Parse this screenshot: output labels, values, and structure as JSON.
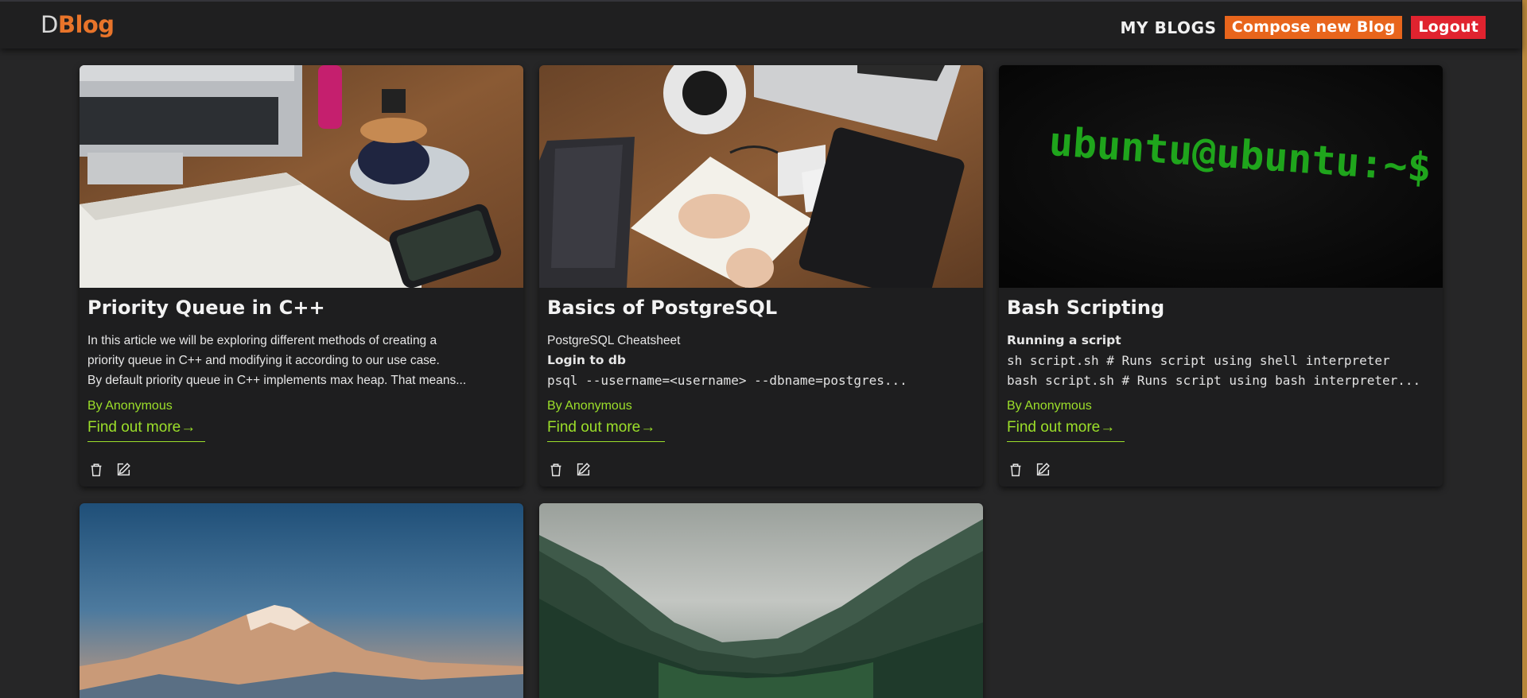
{
  "navbar": {
    "brand_d": "D",
    "brand_blog": "Blog",
    "my_blogs": "MY BLOGS",
    "compose": "Compose new Blog",
    "logout": "Logout"
  },
  "colors": {
    "accent_green": "#9cdf2a",
    "brand_orange": "#e8742a",
    "compose_orange": "#e8651c",
    "logout_red": "#e0232f"
  },
  "cards": [
    {
      "title": "Priority Queue in C++",
      "lines": [
        "In this article we will be exploring different methods of creating a",
        "priority queue in C++ and modifying it according to our use case.",
        "By default priority queue in C++ implements max heap. That means..."
      ],
      "author": "By Anonymous",
      "more": "Find out more→",
      "image": "desk-notebook-coffee-phone",
      "delete_icon": "trash-icon",
      "edit_icon": "edit-icon"
    },
    {
      "title": "Basics of PostgreSQL",
      "line1": "PostgreSQL Cheatsheet",
      "line2": "Login to db",
      "line3": "psql --username=<username> --dbname=postgres...",
      "author": "By Anonymous",
      "more": "Find out more→",
      "image": "desk-journal-writing-tablet",
      "delete_icon": "trash-icon",
      "edit_icon": "edit-icon"
    },
    {
      "title": "Bash Scripting",
      "line1": "Running a script",
      "line2": "sh script.sh  # Runs script using shell interpreter",
      "line3": "bash script.sh # Runs script using bash interpreter...",
      "author": "By Anonymous",
      "more": "Find out more→",
      "image": "terminal-prompt-ubuntu",
      "terminal_text": "ubuntu@ubuntu:~$ |",
      "delete_icon": "trash-icon",
      "edit_icon": "edit-icon"
    },
    {
      "image": "mountain-sunset"
    },
    {
      "image": "misty-forest"
    }
  ]
}
